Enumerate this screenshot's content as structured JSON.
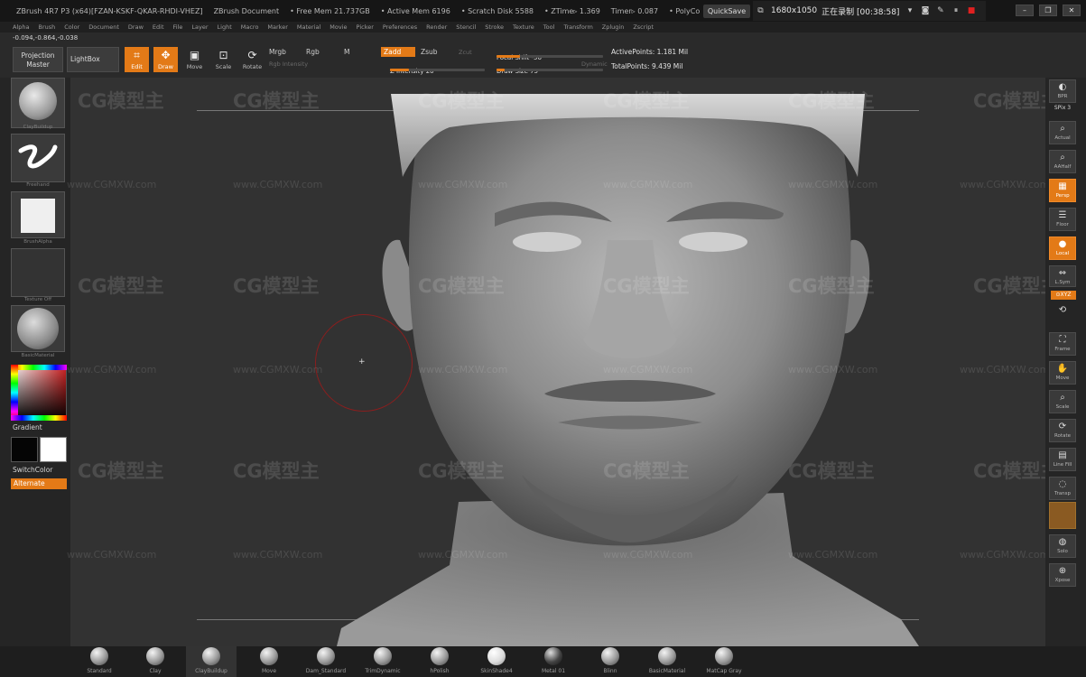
{
  "titlebar": {
    "app_info": "ZBrush 4R7 P3 (x64)[FZAN-KSKF-QKAR-RHDI-VHEZ]",
    "doc_name": "ZBrush Document",
    "free_mem": "• Free Mem 21.737GB",
    "active_mem": "• Active Mem 6196",
    "scratch_disk": "• Scratch Disk 5588",
    "ztime": "• ZTime▹ 1.369",
    "timer": "Timer▹ 0.087",
    "polycount": "• PolyCo",
    "quicksave": "QuickSave",
    "recorder": {
      "resolution": "1680x1050",
      "status": "正在录制 [00:38:58]"
    },
    "window_buttons": [
      "–",
      "❐",
      "✕"
    ]
  },
  "menubar": [
    "Alpha",
    "Brush",
    "Color",
    "Document",
    "Draw",
    "Edit",
    "File",
    "Layer",
    "Light",
    "Macro",
    "Marker",
    "Material",
    "Movie",
    "Picker",
    "Preferences",
    "Render",
    "Stencil",
    "Stroke",
    "Texture",
    "Tool",
    "Transform",
    "Zplugin",
    "Zscript"
  ],
  "toolbar": {
    "coords": "-0.094,-0.864,-0.038",
    "projection_master_1": "Projection",
    "projection_master_2": "Master",
    "lightbox": "LightBox",
    "tools": {
      "edit": "Edit",
      "draw": "Draw",
      "move": "Move",
      "scale": "Scale",
      "rotate": "Rotate"
    },
    "mrgb": "Mrgb",
    "rgb": "Rgb",
    "m": "M",
    "rgb_intensity": "Rgb Intensity",
    "zadd": "Zadd",
    "zsub": "Zsub",
    "zcut": "Zcut",
    "z_intensity": "Z Intensity 20",
    "focal_shift": "Focal Shift -56",
    "draw_size": "Draw Size 75",
    "dynamic": "Dynamic",
    "active_points": "ActivePoints: 1.181 Mil",
    "total_points": "TotalPoints: 9.439 Mil",
    "z_intensity_level": 0.2,
    "focal_shift_level": 0.22,
    "draw_size_level": 0.08
  },
  "left_shelf": {
    "brush_label": "ClayBuildup",
    "stroke_label": "Freehand",
    "alpha_label": "BrushAlpha",
    "texture_label": "Texture Off",
    "material_label": "BasicMaterial",
    "gradient": "Gradient",
    "switchcolor": "SwitchColor",
    "alternate": "Alternate"
  },
  "right_shelf": {
    "bpr": "BPR",
    "spix": "SPix 3",
    "actual": "Actual",
    "aahalf": "AAHalf",
    "persp": "Persp",
    "floor": "Floor",
    "local": "Local",
    "lsym": "L.Sym",
    "xyz": "⊙XYZ",
    "frame": "Frame",
    "move": "Move",
    "scale": "Scale",
    "rotate": "Rotate",
    "linefill": "Line Fill",
    "polyf": "PolyF",
    "transp": "Transp",
    "dynamic": "Dynamic",
    "solo": "Solo",
    "xpose": "Xpose"
  },
  "bottom_shelf": [
    "Standard",
    "Clay",
    "ClayBuildup",
    "Move",
    "Dam_Standard",
    "TrimDynamic",
    "hPolish",
    "SkinShade4",
    "Metal 01",
    "Blinn",
    "BasicMaterial",
    "MatCap Gray"
  ],
  "watermark": {
    "brand": "CG模型主",
    "url": "www.CGMXW.com"
  },
  "colors": {
    "accent": "#e37a17",
    "brush_ring": "#8a1e1e",
    "canvas": "#323232"
  },
  "icons": {
    "cursor": "crosshair-icon"
  }
}
